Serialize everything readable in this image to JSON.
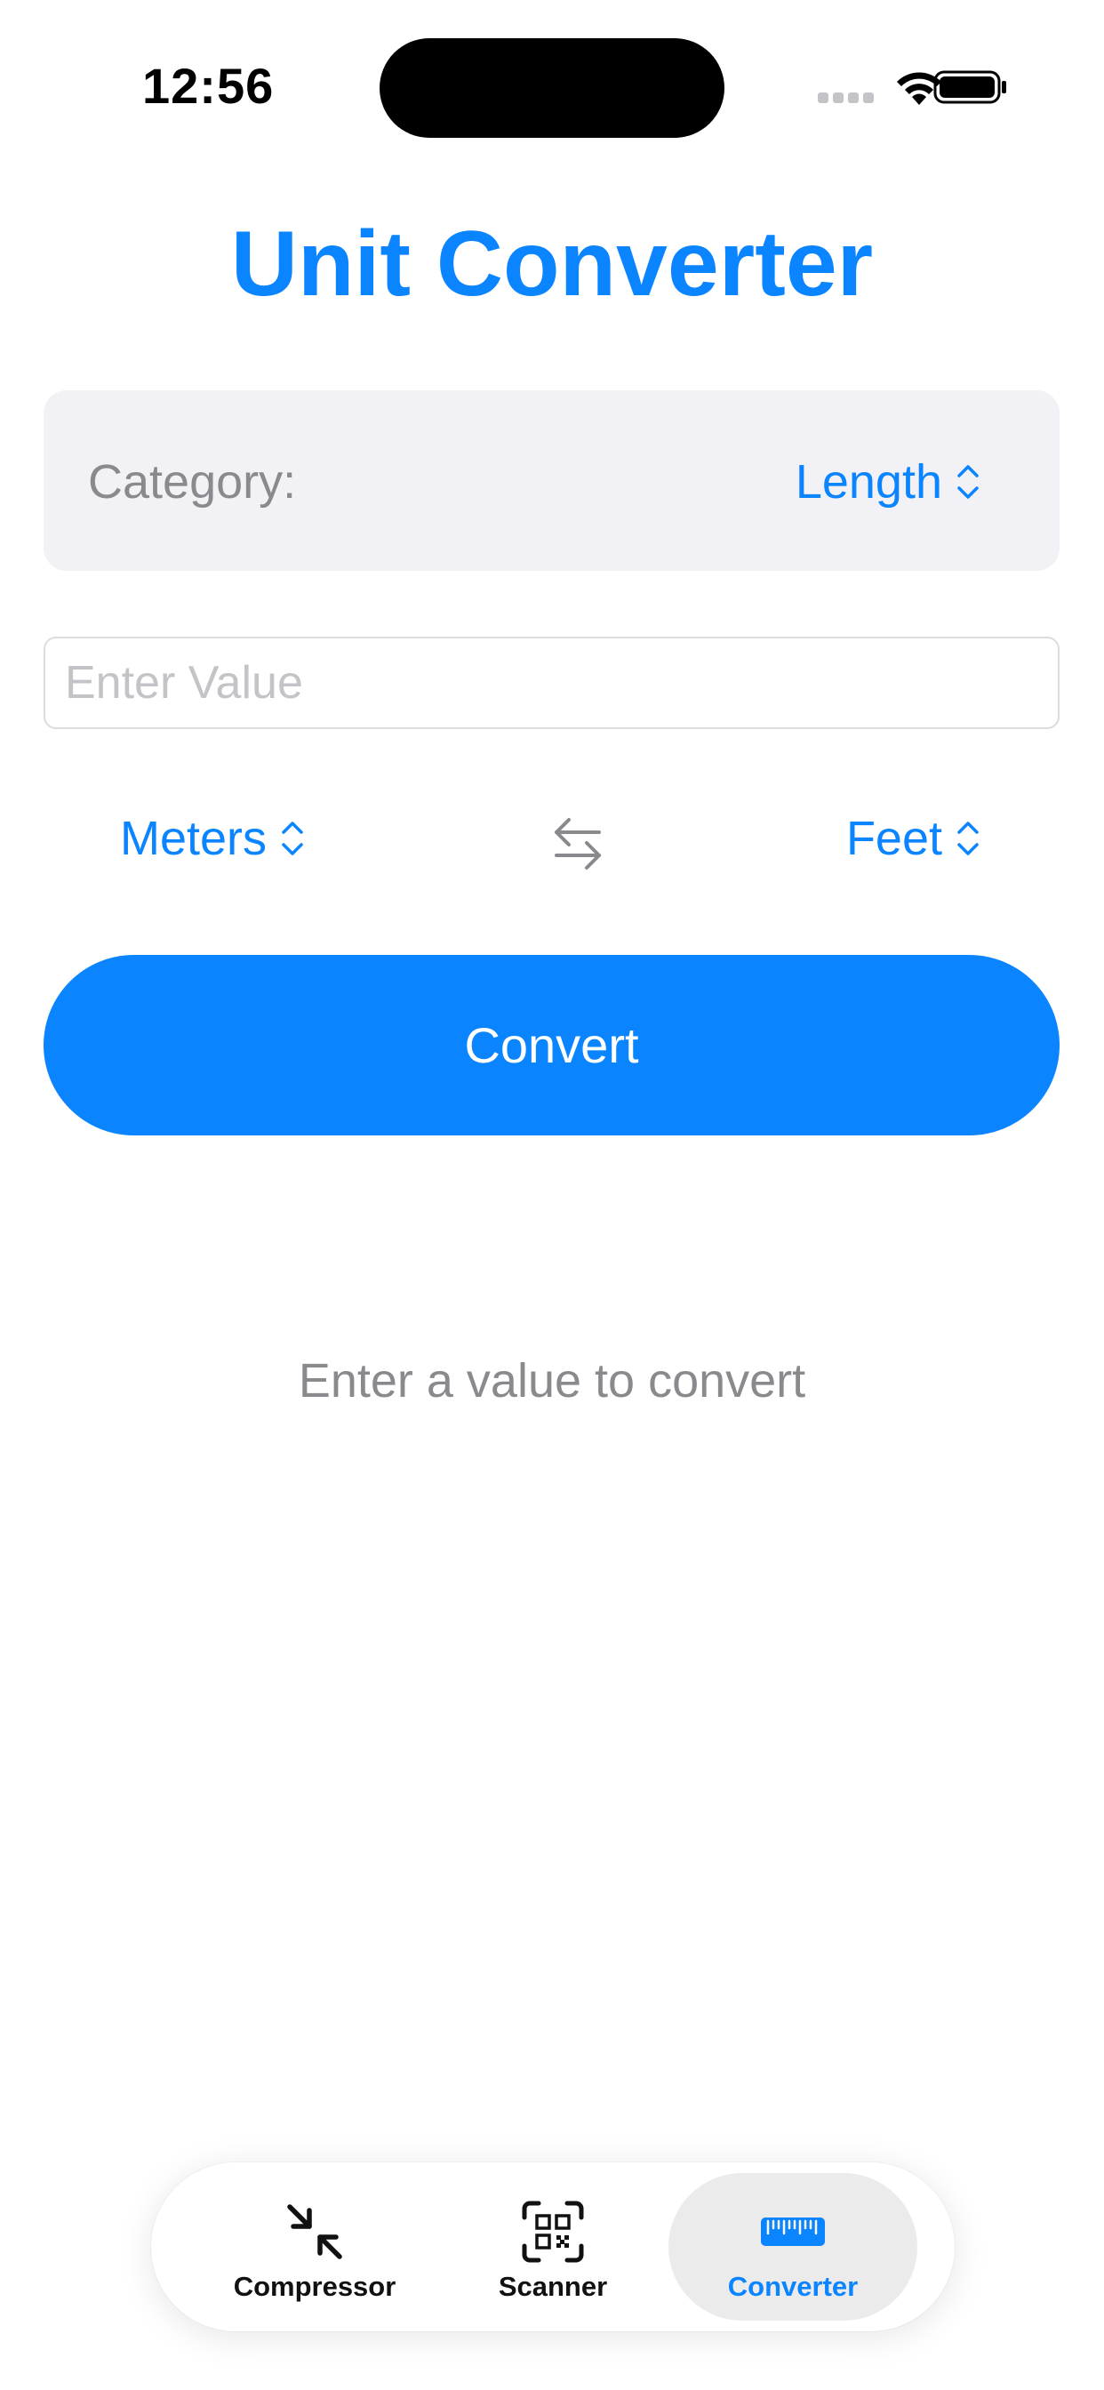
{
  "status_bar": {
    "time": "12:56"
  },
  "title": "Unit Converter",
  "category": {
    "label": "Category:",
    "value": "Length"
  },
  "input": {
    "placeholder": "Enter Value",
    "value": ""
  },
  "units": {
    "from": "Meters",
    "to": "Feet"
  },
  "convert_button": {
    "label": "Convert"
  },
  "result": {
    "text": "Enter a value to convert"
  },
  "tab_bar": {
    "items": [
      {
        "label": "Compressor",
        "icon": "compress-arrows-icon",
        "active": false
      },
      {
        "label": "Scanner",
        "icon": "qr-scanner-icon",
        "active": false
      },
      {
        "label": "Converter",
        "icon": "ruler-icon",
        "active": true
      }
    ]
  },
  "colors": {
    "accent": "#0a84ff",
    "secondary_text": "#8a8a8e",
    "card_background": "#f1f1f6"
  }
}
